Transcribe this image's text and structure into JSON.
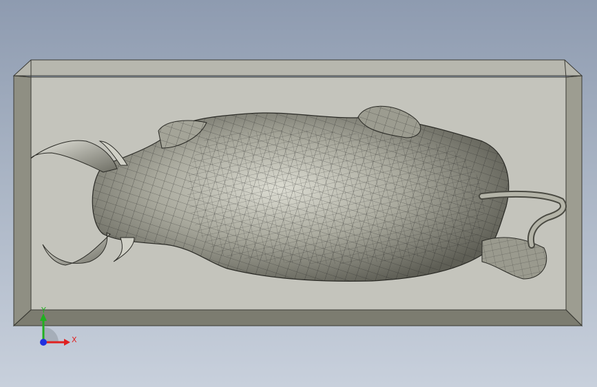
{
  "viewport": {
    "background_top": "#8e9bb0",
    "background_bottom": "#c8d0dc"
  },
  "model": {
    "name_icon": "bull-relief-model",
    "plate_top_color": "#c4c4bc",
    "plate_edge_color": "#9a9a8c",
    "plate_bevel_dark": "#6e6e62",
    "mesh_color": "#1a1a1a",
    "body_color": "#a7a79b"
  },
  "triad": {
    "x_label": "X",
    "y_label": "Y",
    "x_color": "#e02020",
    "y_color": "#20b020",
    "z_color": "#2030e0"
  }
}
